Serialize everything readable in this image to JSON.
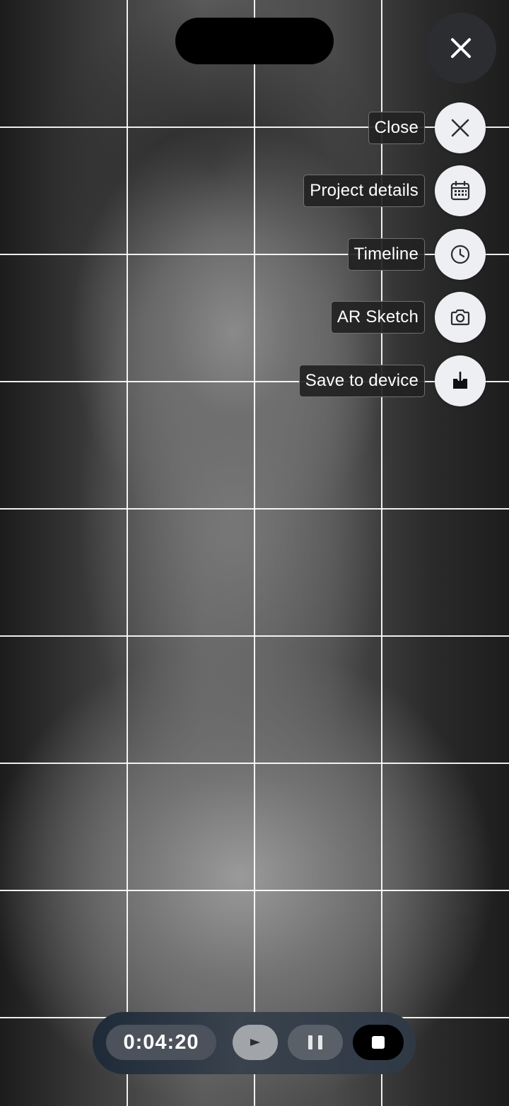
{
  "menu": {
    "items": [
      {
        "label": "Close",
        "icon": "close-icon"
      },
      {
        "label": "Project details",
        "icon": "calendar-icon"
      },
      {
        "label": "Timeline",
        "icon": "clock-icon"
      },
      {
        "label": "AR Sketch",
        "icon": "camera-icon"
      },
      {
        "label": "Save to device",
        "icon": "download-icon"
      }
    ]
  },
  "playback": {
    "timer": "0:04:20"
  },
  "colors": {
    "button_bg": "#eeeff3",
    "controls_bg": "#39424d",
    "grid_line": "#ffffff"
  }
}
